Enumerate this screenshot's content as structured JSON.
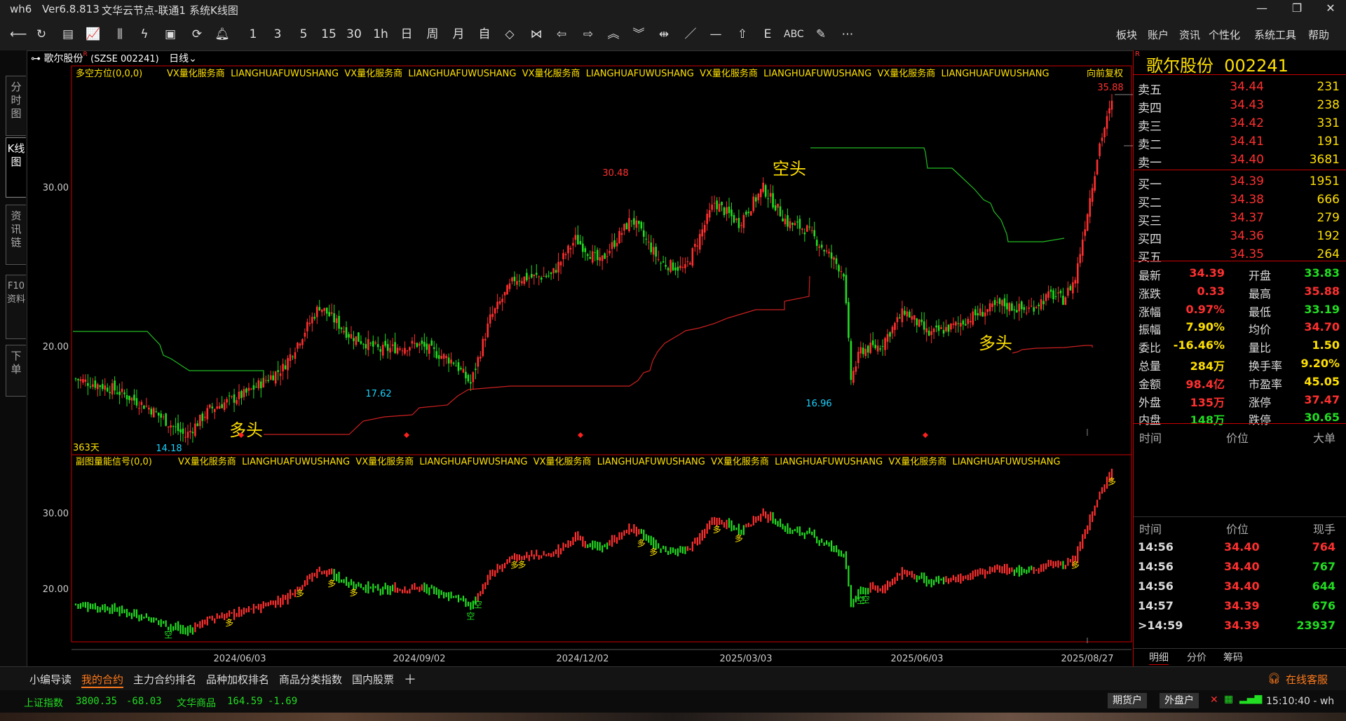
{
  "titlebar": {
    "app": "wh6",
    "version": "Ver6.8.813",
    "server": "文华云节点-联通1",
    "view": "系统K线图"
  },
  "toolbar": {
    "periods": [
      "1",
      "3",
      "5",
      "15",
      "30",
      "1h",
      "日",
      "周",
      "月",
      "自"
    ],
    "draw_label": "ABC",
    "menu": [
      "板块",
      "账户",
      "资讯",
      "个性化",
      "系统工具",
      "帮助"
    ]
  },
  "left_tabs": [
    "分时图",
    "K线图",
    "资讯链",
    "F10资料",
    "下单"
  ],
  "chart_header": {
    "stock": "歌尔股份",
    "sup": "R",
    "code": "(SZSE 002241)",
    "period": "日线",
    "rights": "向前复权"
  },
  "main_indicator": {
    "name": "多空方位(0,0,0)",
    "watermark": "VX量化服务商  LIANGHUAFUWUSHANG  VX量化服务商  LIANGHUAFUWUSHANG  VX量化服务商  LIANGHUAFUWUSHANG  VX量化服务商  LIANGHUAFUWUSHANG  VX量化服务商  LIANGHUAFUWUSHANG",
    "days_label": "363天",
    "annotations": {
      "bull1": "多头",
      "bear": "空头",
      "bull2": "多头"
    }
  },
  "sub_indicator": {
    "name": "副图量能信号(0,0)",
    "watermark": "VX量化服务商  LIANGHUAFUWUSHANG  VX量化服务商  LIANGHUAFUWUSHANG  VX量化服务商  LIANGHUAFUWUSHANG  VX量化服务商  LIANGHUAFUWUSHANG  VX量化服务商  LIANGHUAFUWUSHANG"
  },
  "chart_data": {
    "type": "candlestick",
    "y_ticks_main": [
      "30.00",
      "20.00"
    ],
    "y_ticks_sub": [
      "30.00",
      "20.00"
    ],
    "x_labels": [
      "2024/06/03",
      "2024/09/02",
      "2024/12/02",
      "2025/03/03",
      "2025/06/03",
      "2025/08/27"
    ],
    "price_labels": {
      "high_30_48": "30.48",
      "low_14_18": "14.18",
      "low_17_62": "17.62",
      "low_16_96": "16.96",
      "high_35_88": "35.88"
    },
    "close_path": [
      [
        0,
        18.2
      ],
      [
        15,
        17.6
      ],
      [
        30,
        16.4
      ],
      [
        45,
        14.6
      ],
      [
        55,
        16.3
      ],
      [
        70,
        17.3
      ],
      [
        85,
        18.9
      ],
      [
        100,
        22.8
      ],
      [
        112,
        21.0
      ],
      [
        125,
        20.0
      ],
      [
        140,
        20.4
      ],
      [
        155,
        19.3
      ],
      [
        162,
        17.9
      ],
      [
        170,
        22.0
      ],
      [
        180,
        24.5
      ],
      [
        195,
        24.7
      ],
      [
        205,
        27.0
      ],
      [
        215,
        25.5
      ],
      [
        228,
        28.3
      ],
      [
        240,
        25.5
      ],
      [
        250,
        25.1
      ],
      [
        262,
        29.3
      ],
      [
        272,
        28.0
      ],
      [
        282,
        30.2
      ],
      [
        292,
        28.0
      ],
      [
        300,
        27.6
      ],
      [
        310,
        25.8
      ],
      [
        315,
        24.9
      ],
      [
        318,
        18.2
      ],
      [
        322,
        20.0
      ],
      [
        330,
        20.3
      ],
      [
        340,
        22.5
      ],
      [
        350,
        21.0
      ],
      [
        360,
        21.5
      ],
      [
        370,
        22.3
      ],
      [
        380,
        22.9
      ],
      [
        390,
        22.5
      ],
      [
        400,
        23.5
      ],
      [
        405,
        23.2
      ],
      [
        410,
        24.5
      ],
      [
        420,
        33.0
      ],
      [
        425,
        35.5
      ]
    ],
    "signal_markers": [
      "空",
      "多",
      "多",
      "多",
      "多",
      "空",
      "空",
      "多",
      "多",
      "多",
      "多",
      "多",
      "多",
      "空",
      "空",
      "多",
      "多"
    ]
  },
  "quote": {
    "name": "歌尔股份",
    "code": "002241",
    "asks": [
      {
        "label": "卖五",
        "price": "34.44",
        "vol": "231"
      },
      {
        "label": "卖四",
        "price": "34.43",
        "vol": "238"
      },
      {
        "label": "卖三",
        "price": "34.42",
        "vol": "331"
      },
      {
        "label": "卖二",
        "price": "34.41",
        "vol": "191"
      },
      {
        "label": "卖一",
        "price": "34.40",
        "vol": "3681"
      }
    ],
    "bids": [
      {
        "label": "买一",
        "price": "34.39",
        "vol": "1951"
      },
      {
        "label": "买二",
        "price": "34.38",
        "vol": "666"
      },
      {
        "label": "买三",
        "price": "34.37",
        "vol": "279"
      },
      {
        "label": "买四",
        "price": "34.36",
        "vol": "192"
      },
      {
        "label": "买五",
        "price": "34.35",
        "vol": "264"
      }
    ],
    "stats": [
      {
        "l": "最新",
        "v": "34.39",
        "c": "red",
        "l2": "开盘",
        "v2": "33.83",
        "c2": "grn"
      },
      {
        "l": "涨跌",
        "v": "0.33",
        "c": "red",
        "l2": "最高",
        "v2": "35.88",
        "c2": "red"
      },
      {
        "l": "涨幅",
        "v": "0.97%",
        "c": "red",
        "l2": "最低",
        "v2": "33.19",
        "c2": "grn"
      },
      {
        "l": "振幅",
        "v": "7.90%",
        "c": "yel",
        "l2": "均价",
        "v2": "34.70",
        "c2": "red"
      },
      {
        "l": "委比",
        "v": "-16.46%",
        "c": "yel",
        "l2": "量比",
        "v2": "1.50",
        "c2": "yel"
      },
      {
        "l": "总量",
        "v": "284万",
        "c": "yel",
        "l2": "换手率",
        "v2": "9.20%",
        "c2": "yel"
      },
      {
        "l": "金额",
        "v": "98.4亿",
        "c": "red",
        "l2": "市盈率",
        "v2": "45.05",
        "c2": "yel"
      },
      {
        "l": "外盘",
        "v": "135万",
        "c": "red",
        "l2": "涨停",
        "v2": "37.47",
        "c2": "red"
      },
      {
        "l": "内盘",
        "v": "148万",
        "c": "grn",
        "l2": "跌停",
        "v2": "30.65",
        "c2": "grn"
      }
    ],
    "big_header": {
      "time": "时间",
      "price": "价位",
      "big": "大单"
    },
    "tick_header": {
      "time": "时间",
      "price": "价位",
      "now": "现手"
    },
    "ticks": [
      {
        "t": "14:56",
        "p": "34.40",
        "q": "764",
        "qc": "red"
      },
      {
        "t": "14:56",
        "p": "34.40",
        "q": "767",
        "qc": "grn"
      },
      {
        "t": "14:56",
        "p": "34.40",
        "q": "644",
        "qc": "grn"
      },
      {
        "t": "14:57",
        "p": "34.39",
        "q": "676",
        "qc": "grn"
      },
      {
        "t": ">14:59",
        "p": "34.39",
        "q": "23937",
        "qc": "grn"
      }
    ],
    "bottom_tabs": [
      "明细",
      "分价",
      "筹码"
    ]
  },
  "bottom_tabs": [
    "小编导读",
    "我的合约",
    "主力合约排名",
    "品种加权排名",
    "商品分类指数",
    "国内股票"
  ],
  "service": "在线客服",
  "status": {
    "idx1_name": "上证指数",
    "idx1_val": "3800.35",
    "idx1_chg": "-68.03",
    "idx2_name": "文华商品",
    "idx2_val": "164.59",
    "idx2_chg": "-1.69",
    "btn1": "期货户",
    "btn2": "外盘户",
    "clock": "15:10:40 - wh"
  },
  "colors": {
    "up": "#ff3030",
    "down": "#22dd22",
    "label": "#ffe000",
    "accent": "#ff7a1a"
  }
}
